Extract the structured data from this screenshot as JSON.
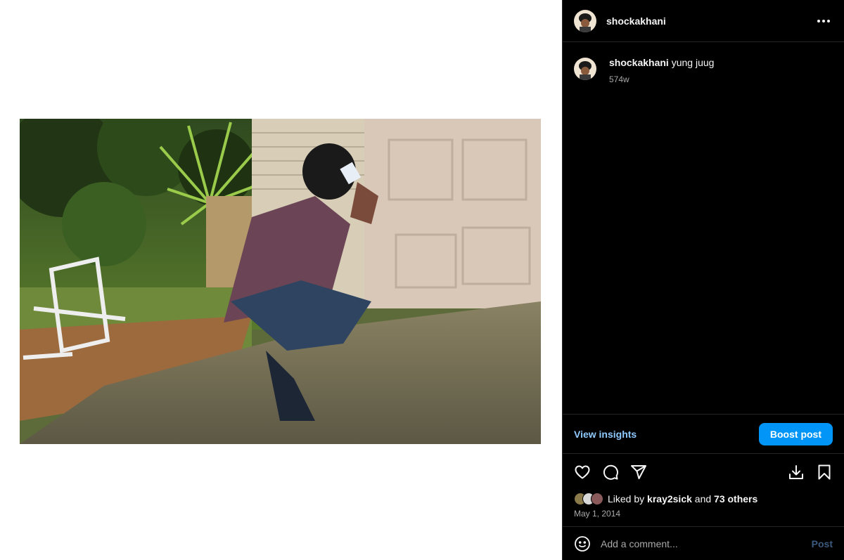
{
  "post": {
    "username": "shockakhani",
    "caption": {
      "username": "shockakhani",
      "text": "yung juug",
      "time": "574w"
    },
    "insights_label": "View insights",
    "boost_label": "Boost post",
    "likes": {
      "prefix": "Liked by",
      "user": "kray2sick",
      "connector": "and",
      "others": "73 others"
    },
    "date": "May 1, 2014",
    "comment": {
      "placeholder": "Add a comment...",
      "post_label": "Post"
    }
  },
  "icons": {
    "more": "more-options-icon",
    "like": "heart-icon",
    "comment": "comment-icon",
    "share": "share-icon",
    "download": "download-icon",
    "save": "bookmark-icon",
    "emoji": "emoji-icon"
  },
  "colors": {
    "accent": "#0095f6",
    "link": "#8fcaff",
    "background": "#000000",
    "border": "#262626",
    "muted": "#a8a8a8"
  }
}
